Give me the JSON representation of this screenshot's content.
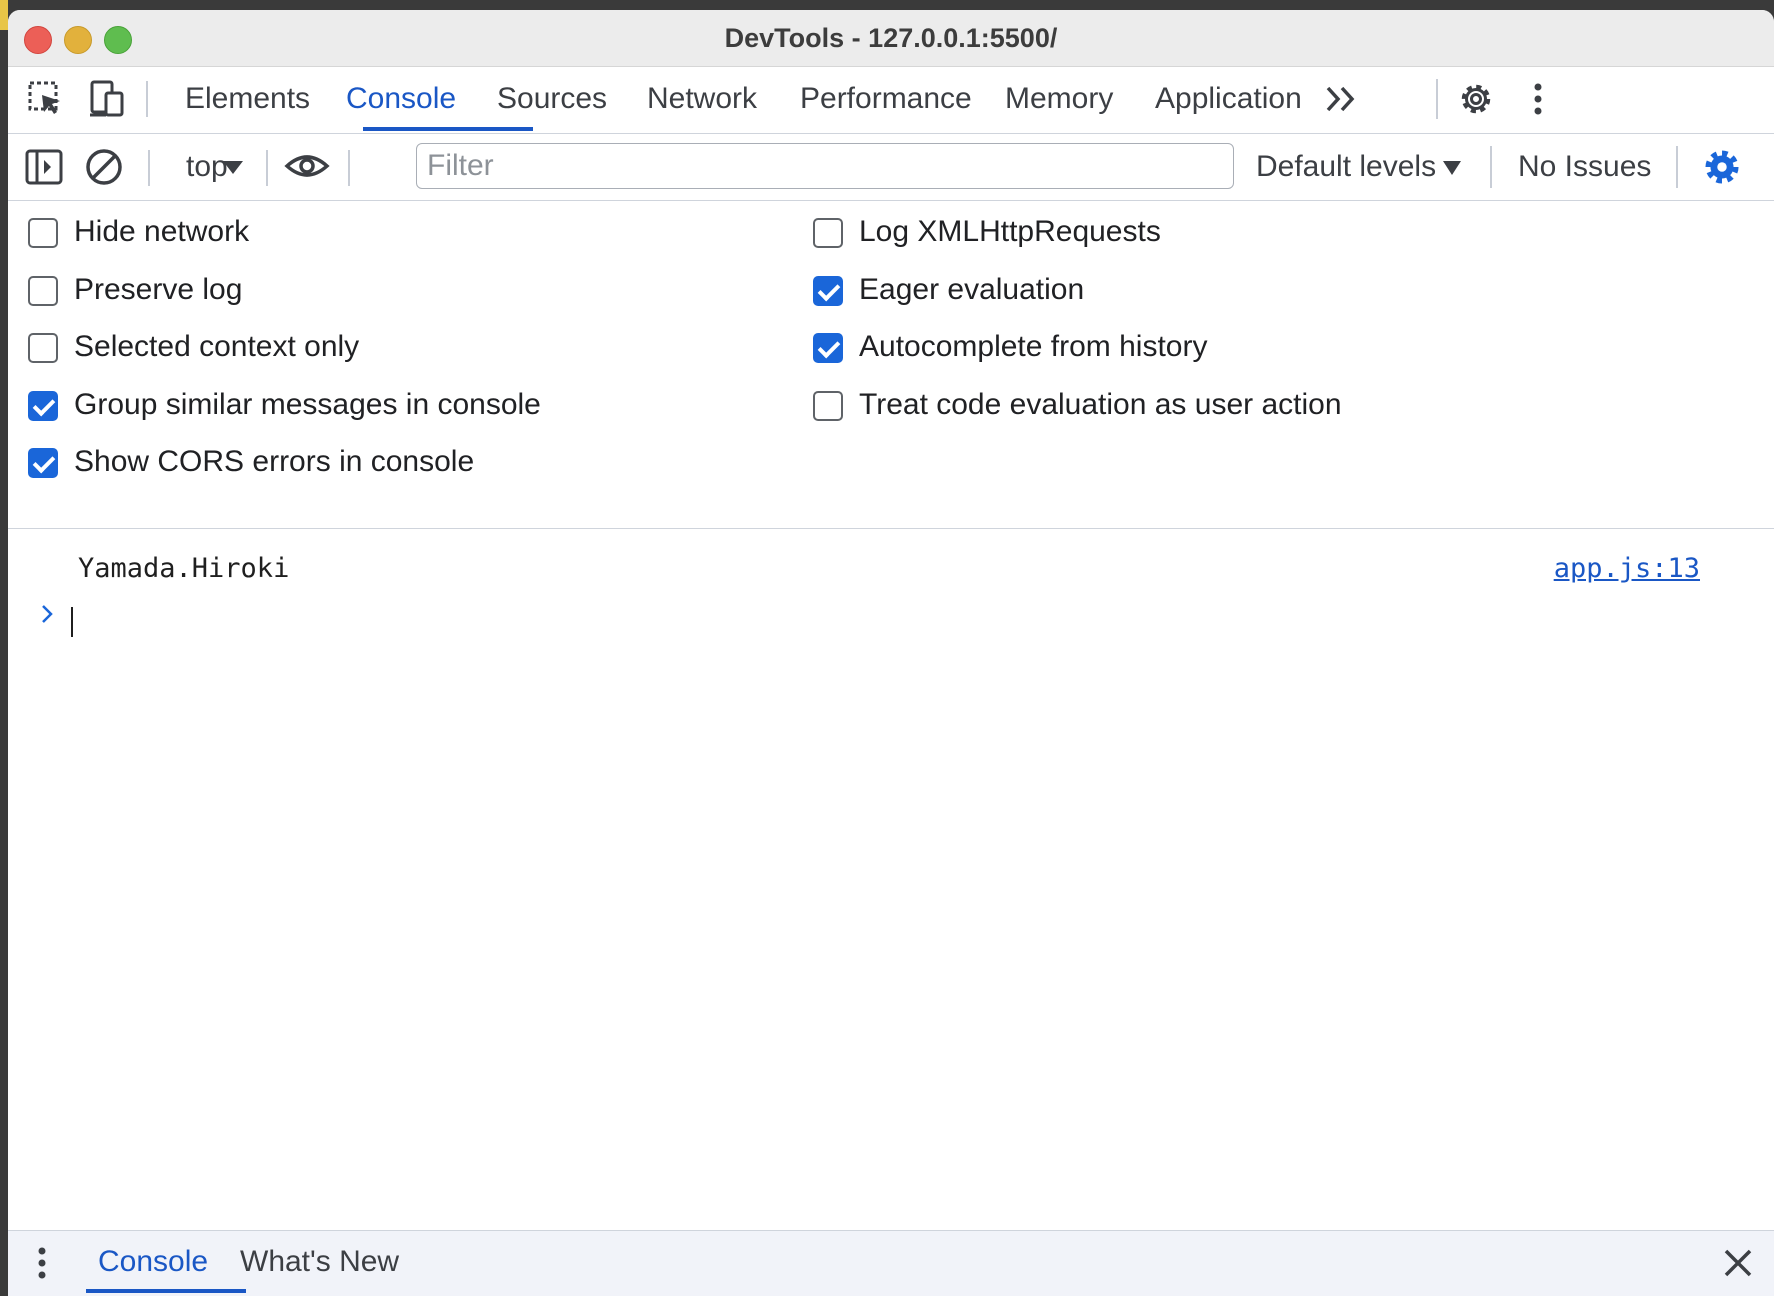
{
  "window": {
    "title": "DevTools - 127.0.0.1:5500/"
  },
  "tabs": [
    {
      "label": "Elements",
      "active": false
    },
    {
      "label": "Console",
      "active": true
    },
    {
      "label": "Sources",
      "active": false
    },
    {
      "label": "Network",
      "active": false
    },
    {
      "label": "Performance",
      "active": false
    },
    {
      "label": "Memory",
      "active": false
    },
    {
      "label": "Application",
      "active": false
    }
  ],
  "toolbar": {
    "context": "top",
    "filter_placeholder": "Filter",
    "filter_value": "",
    "levels": "Default levels",
    "issues": "No Issues"
  },
  "settings": {
    "left": [
      {
        "label": "Hide network",
        "checked": false
      },
      {
        "label": "Preserve log",
        "checked": false
      },
      {
        "label": "Selected context only",
        "checked": false
      },
      {
        "label": "Group similar messages in console",
        "checked": true
      },
      {
        "label": "Show CORS errors in console",
        "checked": true
      }
    ],
    "right": [
      {
        "label": "Log XMLHttpRequests",
        "checked": false
      },
      {
        "label": "Eager evaluation",
        "checked": true
      },
      {
        "label": "Autocomplete from history",
        "checked": true
      },
      {
        "label": "Treat code evaluation as user action",
        "checked": false
      }
    ]
  },
  "console": {
    "messages": [
      {
        "text": "Yamada.Hiroki",
        "source": "app.js:13"
      }
    ],
    "prompt_value": ""
  },
  "drawer": {
    "tabs": [
      {
        "label": "Console",
        "active": true
      },
      {
        "label": "What's New",
        "active": false
      }
    ]
  },
  "colors": {
    "accent": "#1a57c5",
    "checkbox_checked": "#1a66d9"
  },
  "icons": {
    "toolbar": [
      "inspect-element-icon",
      "device-toolbar-icon",
      "more-tabs-icon",
      "settings-gear-icon",
      "more-options-icon"
    ],
    "console": [
      "sidebar-toggle-icon",
      "clear-console-icon",
      "live-expression-eye-icon",
      "console-settings-gear-icon"
    ],
    "drawer": [
      "drawer-menu-icon",
      "close-drawer-icon"
    ]
  }
}
